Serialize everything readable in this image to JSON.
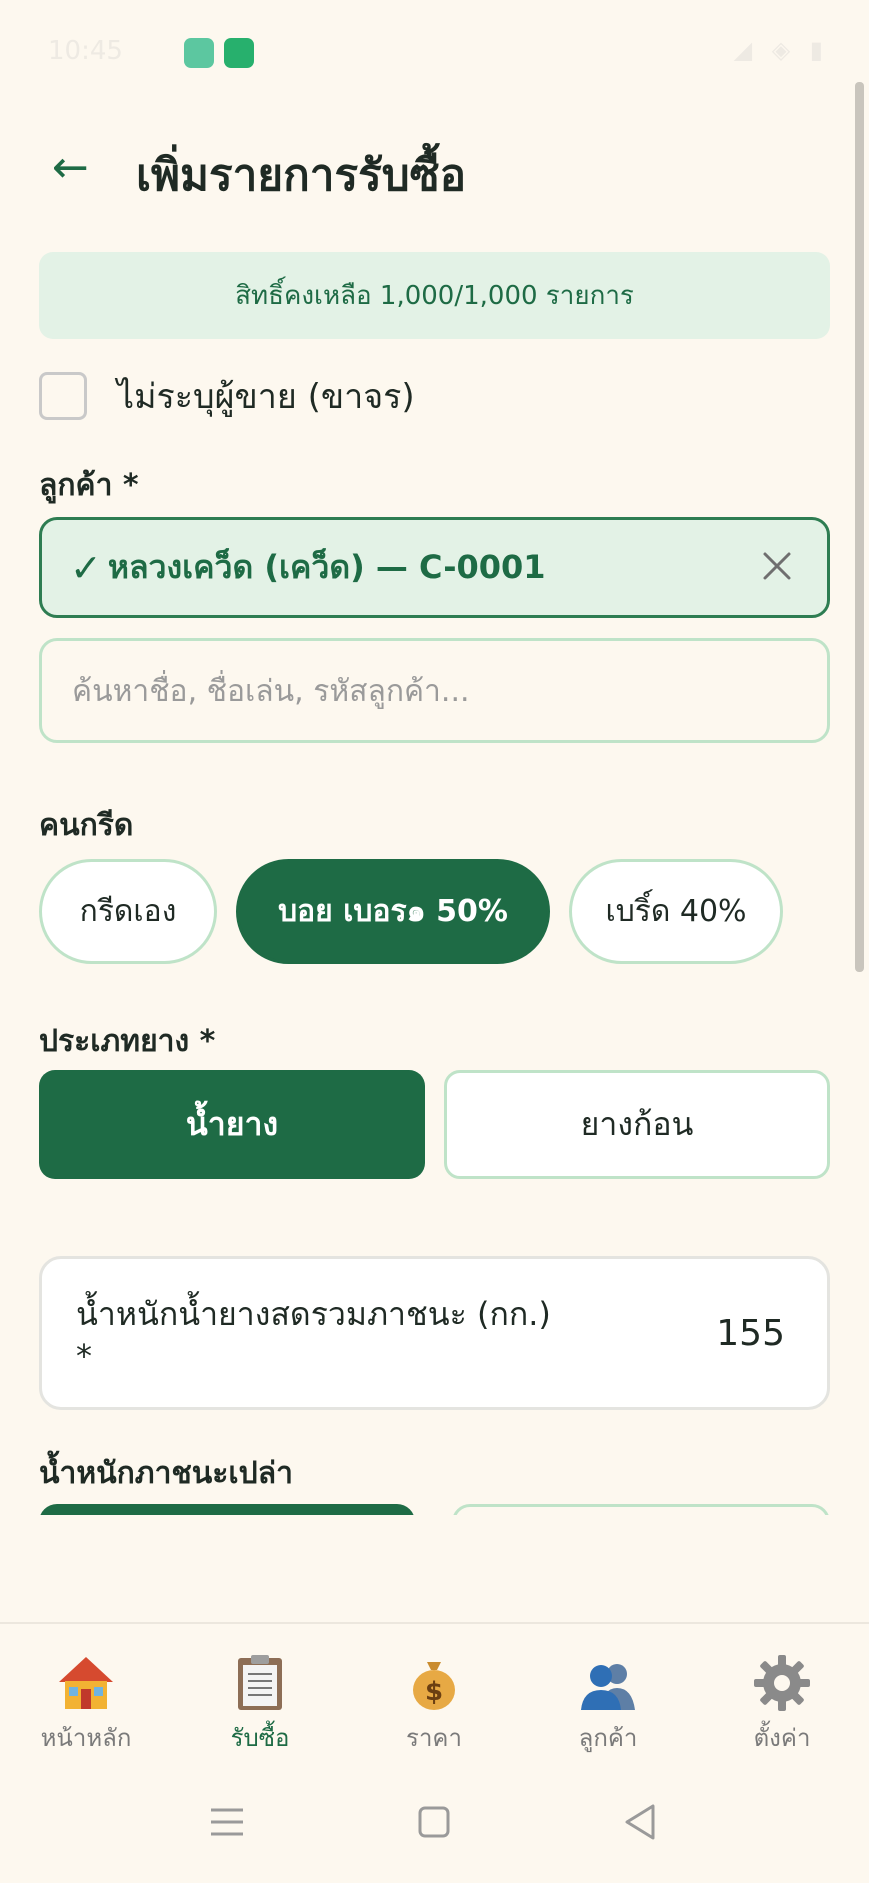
{
  "status_bar": {
    "time": "10:45"
  },
  "header": {
    "back_icon": "←",
    "title": "เพิ่มรายการรับซื้อ"
  },
  "quota_banner": "สิทธิ์คงเหลือ 1,000/1,000 รายการ",
  "anonymous_seller": {
    "label": "ไม่ระบุผู้ขาย (ขาจร)",
    "checked": false
  },
  "customer": {
    "label": "ลูกค้า *",
    "selected_check": "✓",
    "selected_name": "หลวงเคว็ด (เคว็ด) — C-0001",
    "search_placeholder": "ค้นหาชื่อ, ชื่อเล่น, รหัสลูกค้า...",
    "search_value": ""
  },
  "tapper": {
    "label": "คนกรีด",
    "options": [
      {
        "label": "กรีดเอง",
        "selected": false
      },
      {
        "label": "บอย เบอร๑ 50%",
        "selected": true
      },
      {
        "label": "เบริ์ด 40%",
        "selected": false
      }
    ]
  },
  "rubber_type": {
    "label": "ประเภทยาง *",
    "options": [
      {
        "label": "น้ำยาง",
        "selected": true
      },
      {
        "label": "ยางก้อน",
        "selected": false
      }
    ]
  },
  "weight": {
    "label": "น้ำหนักน้ำยางสดรวมภาชนะ (กก.) *",
    "value": "155"
  },
  "container_weight": {
    "label": "น้ำหนักภาชนะเปล่า"
  },
  "bottom_nav": [
    {
      "label": "หน้าหลัก",
      "icon": "house-icon",
      "active": false
    },
    {
      "label": "รับซื้อ",
      "icon": "clipboard-icon",
      "active": true
    },
    {
      "label": "ราคา",
      "icon": "money-bag-icon",
      "active": false
    },
    {
      "label": "ลูกค้า",
      "icon": "users-icon",
      "active": false
    },
    {
      "label": "ตั้งค่า",
      "icon": "gear-icon",
      "active": false
    }
  ],
  "colors": {
    "primary": "#1e6b45",
    "background": "#fdf8ef",
    "light_green": "#e3f2e6",
    "border_green": "#bfe3c8"
  }
}
